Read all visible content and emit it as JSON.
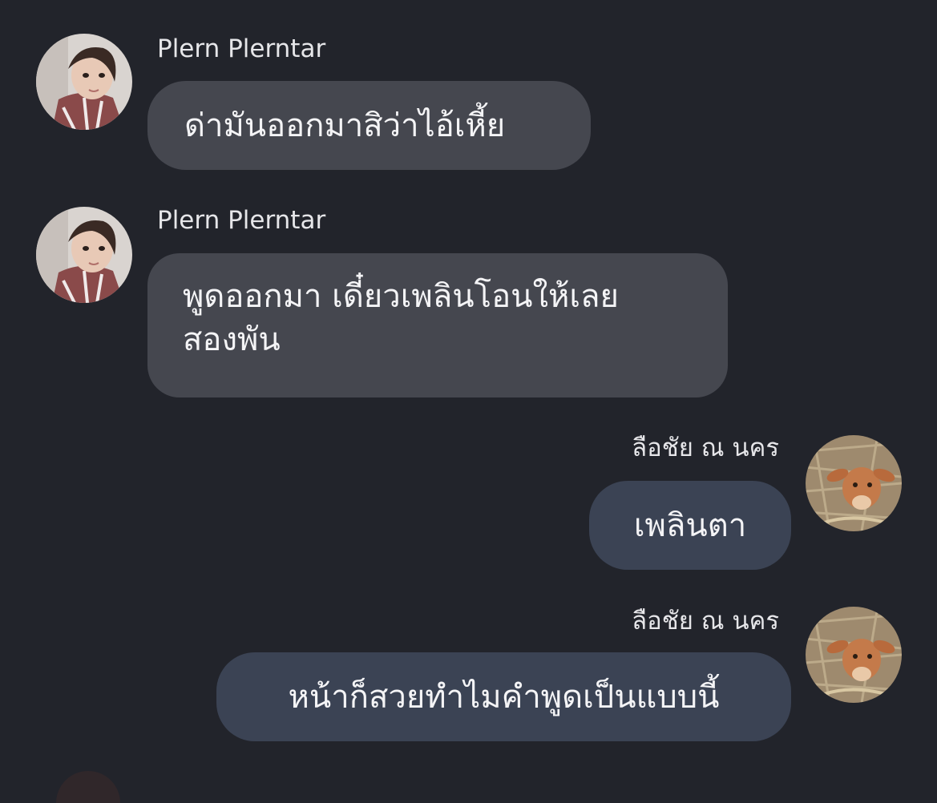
{
  "messages": [
    {
      "sender": "Plern Plerntar",
      "text": "ด่ามันออกมาสิว่าไอ้เหี้ย",
      "side": "incoming",
      "avatar": "woman-portrait-avatar"
    },
    {
      "sender": "Plern Plerntar",
      "text_line1": "พูดออกมา เดี๋ยวเพลินโอนให้เลย",
      "text_line2": "สองพัน",
      "side": "incoming",
      "avatar": "woman-portrait-avatar"
    },
    {
      "sender": "ลือชัย ณ นคร",
      "text": "เพลินตา",
      "side": "outgoing",
      "avatar": "calf-avatar"
    },
    {
      "sender": "ลือชัย ณ นคร",
      "text": "หน้าก็สวยทำไมคำพูดเป็นแบบนี้",
      "side": "outgoing",
      "avatar": "calf-avatar"
    }
  ],
  "colors": {
    "background": "#22242b",
    "incoming_bubble": "#45474f",
    "outgoing_bubble": "#3b4354",
    "text": "#f4f4f6"
  }
}
